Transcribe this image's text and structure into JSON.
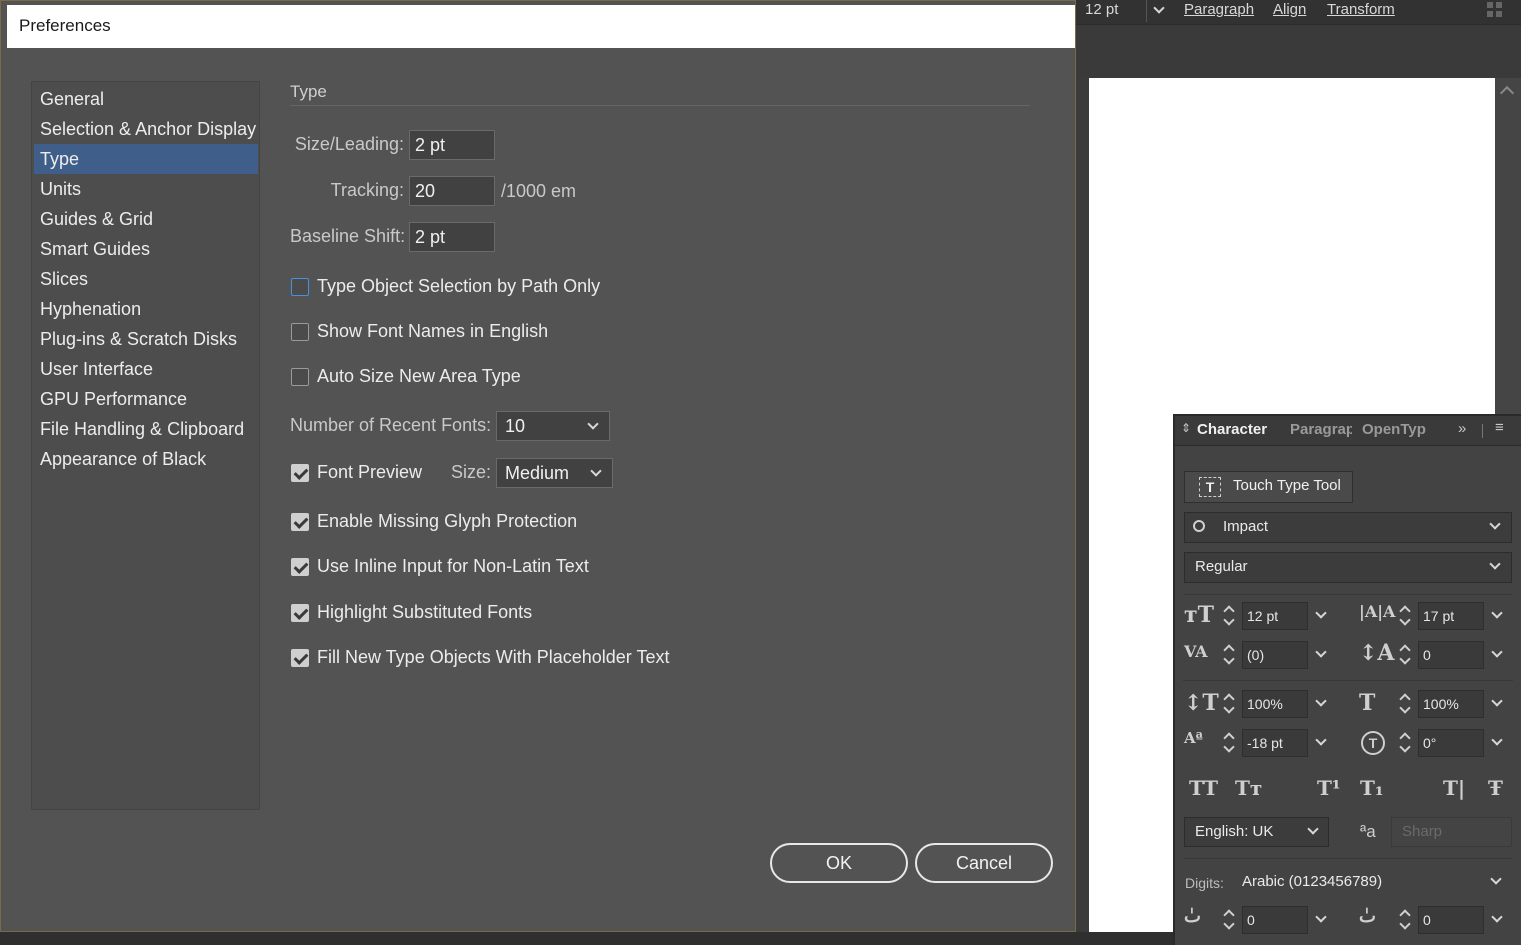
{
  "app": {
    "topbar": {
      "font_size": "12 pt",
      "links": [
        "Paragraph",
        "Align",
        "Transform"
      ]
    }
  },
  "dialog": {
    "title": "Preferences",
    "categories": [
      "General",
      "Selection & Anchor Display",
      "Type",
      "Units",
      "Guides & Grid",
      "Smart Guides",
      "Slices",
      "Hyphenation",
      "Plug-ins & Scratch Disks",
      "User Interface",
      "GPU Performance",
      "File Handling & Clipboard",
      "Appearance of Black"
    ],
    "selected_category": "Type",
    "section_title": "Type",
    "size_leading": {
      "label": "Size/Leading:",
      "value": "2 pt"
    },
    "tracking": {
      "label": "Tracking:",
      "value": "20",
      "unit": "/1000 em"
    },
    "baseline_shift": {
      "label": "Baseline Shift:",
      "value": "2 pt"
    },
    "checkboxes": [
      {
        "label": "Type Object Selection by Path Only",
        "checked": false
      },
      {
        "label": "Show Font Names in English",
        "checked": false
      },
      {
        "label": "Auto Size New Area Type",
        "checked": false
      }
    ],
    "recent_fonts": {
      "label": "Number of Recent Fonts:",
      "value": "10"
    },
    "font_preview": {
      "label": "Font Preview",
      "checked": true,
      "size_label": "Size:",
      "size_value": "Medium"
    },
    "checkboxes2": [
      {
        "label": "Enable Missing Glyph Protection",
        "checked": true
      },
      {
        "label": "Use Inline Input for Non-Latin Text",
        "checked": true
      },
      {
        "label": "Highlight Substituted Fonts",
        "checked": true
      },
      {
        "label": "Fill New Type Objects With Placeholder Text",
        "checked": true
      }
    ],
    "ok_label": "OK",
    "cancel_label": "Cancel"
  },
  "character_panel": {
    "tabs": [
      "Character",
      "Paragrap",
      "OpenTyp"
    ],
    "touch_type_label": "Touch Type Tool",
    "font_family": "Impact",
    "font_style": "Regular",
    "font_size": "12 pt",
    "leading": "17 pt",
    "kerning": "(0)",
    "tracking": "0",
    "vertical_scale": "100%",
    "horizontal_scale": "100%",
    "baseline_shift": "-18 pt",
    "rotation": "0°",
    "language": "English: UK",
    "antialias": "Sharp",
    "digits_label": "Digits:",
    "digits_value": "Arabic (0123456789)",
    "bottom_left": "0",
    "bottom_right": "0",
    "colors": {
      "accent": "#3f5f8a",
      "panel": "#434343"
    }
  }
}
